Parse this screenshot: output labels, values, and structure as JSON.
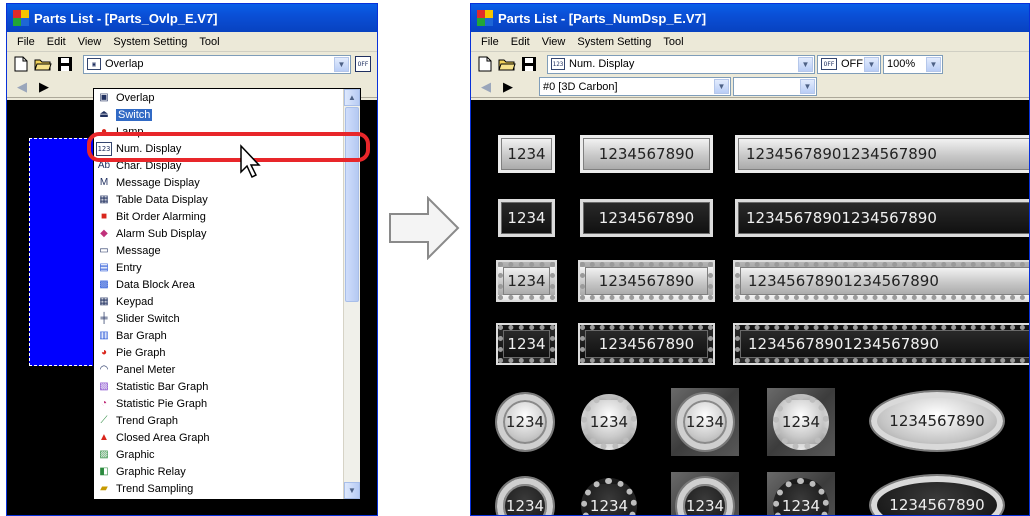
{
  "left_window": {
    "title": "Parts List - [Parts_Ovlp_E.V7]",
    "menu": [
      "File",
      "Edit",
      "View",
      "System Setting",
      "Tool"
    ],
    "combo_value": "Overlap",
    "dropdown_items": [
      {
        "label": "Overlap",
        "icon": "overlap-icon"
      },
      {
        "label": "Switch",
        "icon": "switch-icon",
        "selected": true
      },
      {
        "label": "Lamp",
        "icon": "lamp-icon"
      },
      {
        "label": "Num. Display",
        "icon": "num-display-icon"
      },
      {
        "label": "Char. Display",
        "icon": "char-display-icon"
      },
      {
        "label": "Message Display",
        "icon": "message-display-icon"
      },
      {
        "label": "Table Data Display",
        "icon": "table-data-display-icon"
      },
      {
        "label": "Bit Order Alarming",
        "icon": "bit-order-alarming-icon"
      },
      {
        "label": "Alarm Sub Display",
        "icon": "alarm-sub-display-icon"
      },
      {
        "label": "Message",
        "icon": "message-icon"
      },
      {
        "label": "Entry",
        "icon": "entry-icon"
      },
      {
        "label": "Data Block Area",
        "icon": "data-block-area-icon"
      },
      {
        "label": "Keypad",
        "icon": "keypad-icon"
      },
      {
        "label": "Slider Switch",
        "icon": "slider-switch-icon"
      },
      {
        "label": "Bar Graph",
        "icon": "bar-graph-icon"
      },
      {
        "label": "Pie Graph",
        "icon": "pie-graph-icon"
      },
      {
        "label": "Panel Meter",
        "icon": "panel-meter-icon"
      },
      {
        "label": "Statistic Bar Graph",
        "icon": "statistic-bar-graph-icon"
      },
      {
        "label": "Statistic Pie Graph",
        "icon": "statistic-pie-graph-icon"
      },
      {
        "label": "Trend Graph",
        "icon": "trend-graph-icon"
      },
      {
        "label": "Closed Area Graph",
        "icon": "closed-area-graph-icon"
      },
      {
        "label": "Graphic",
        "icon": "graphic-icon"
      },
      {
        "label": "Graphic Relay",
        "icon": "graphic-relay-icon"
      },
      {
        "label": "Trend Sampling",
        "icon": "trend-sampling-icon"
      }
    ]
  },
  "right_window": {
    "title": "Parts List - [Parts_NumDsp_E.V7]",
    "menu": [
      "File",
      "Edit",
      "View",
      "System Setting",
      "Tool"
    ],
    "combo_value": "Num. Display",
    "off_label": "OFF",
    "zoom": "100%",
    "style_value": "#0 [3D Carbon]",
    "style_second_value": "",
    "displays": {
      "short": "1234",
      "medium": "1234567890",
      "long": "12345678901234567890"
    }
  },
  "colors": {
    "title_bar": "#0a4fd6",
    "highlight": "#e8262a",
    "selection": "#316ac5",
    "canvas": "#000000",
    "part_blue": "#0000ff"
  }
}
